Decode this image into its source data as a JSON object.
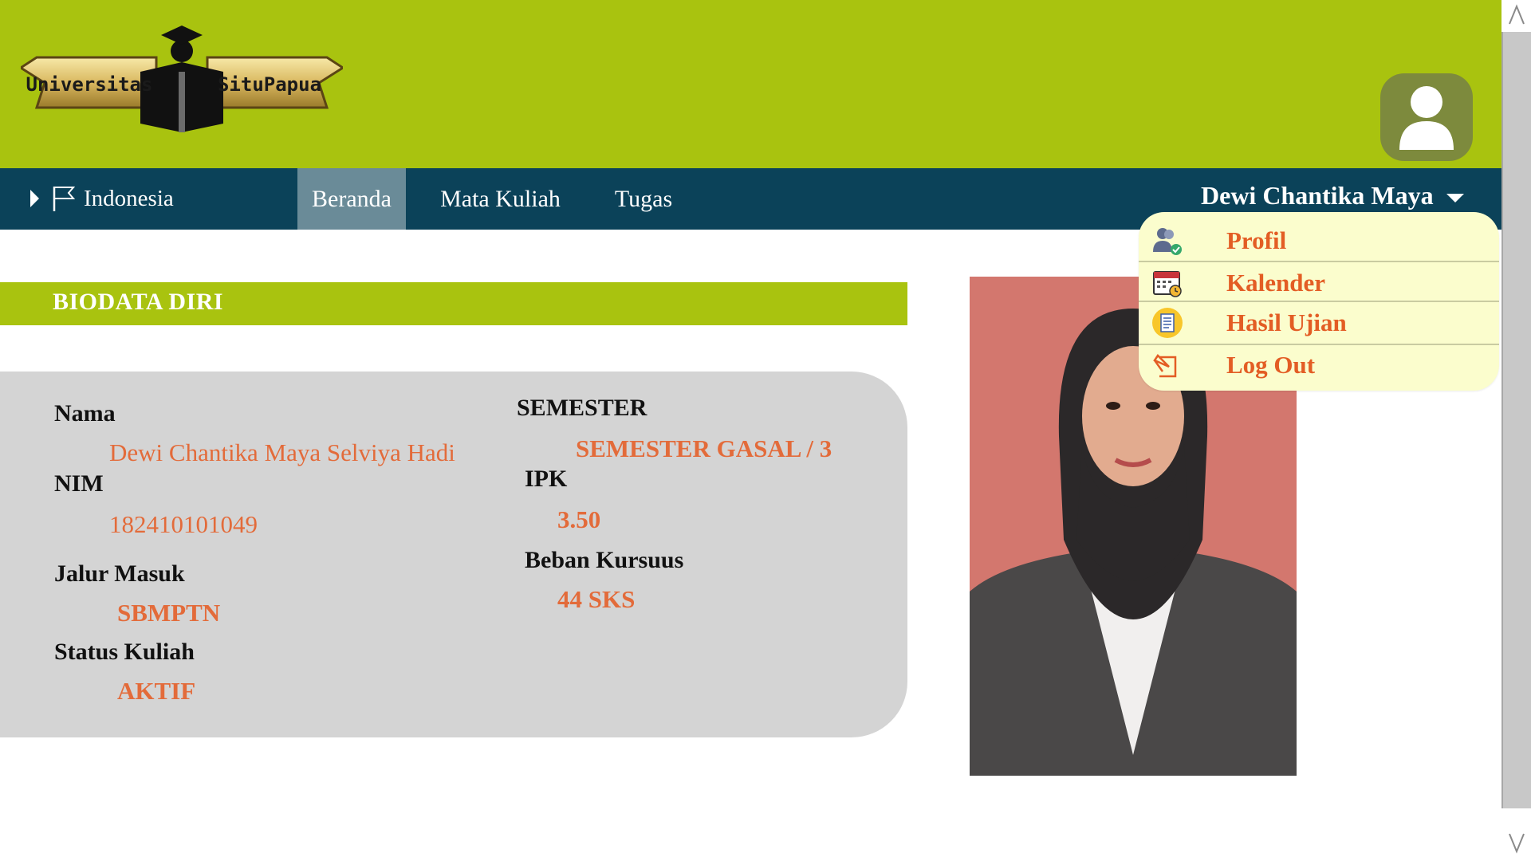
{
  "header": {
    "logo_left_text": "Universitas",
    "logo_right_text": "SituPapua",
    "avatar_icon": "user-avatar-icon"
  },
  "nav": {
    "language": "Indonesia",
    "items": [
      {
        "label": "Beranda",
        "active": true
      },
      {
        "label": "Mata Kuliah",
        "active": false
      },
      {
        "label": "Tugas",
        "active": false
      }
    ],
    "user_name": "Dewi Chantika Maya"
  },
  "dropdown": {
    "items": [
      {
        "label": "Profil",
        "icon": "profile-icon"
      },
      {
        "label": "Kalender",
        "icon": "calendar-icon"
      },
      {
        "label": "Hasil Ujian",
        "icon": "exam-results-icon"
      },
      {
        "label": "Log Out",
        "icon": "logout-icon"
      }
    ]
  },
  "biodata": {
    "title": "BIODATA DIRI",
    "nama_label": "Nama",
    "nama_value": "Dewi Chantika Maya Selviya Hadi",
    "nim_label": "NIM",
    "nim_value": "182410101049",
    "jalur_label": "Jalur Masuk",
    "jalur_value": "SBMPTN",
    "status_label": "Status Kuliah",
    "status_value": "AKTIF",
    "semester_label": "SEMESTER",
    "semester_value": "SEMESTER GASAL / 3",
    "ipk_label": "IPK",
    "ipk_value": "3.50",
    "beban_label": "Beban Kursuus",
    "beban_value": "44 SKS"
  },
  "colors": {
    "header_green": "#a9c30f",
    "nav_blue": "#0b4259",
    "active_tab": "#6a8b98",
    "accent_orange": "#e36b3a",
    "dropdown_bg": "#fbfdcd",
    "card_grey": "#d4d4d4"
  }
}
